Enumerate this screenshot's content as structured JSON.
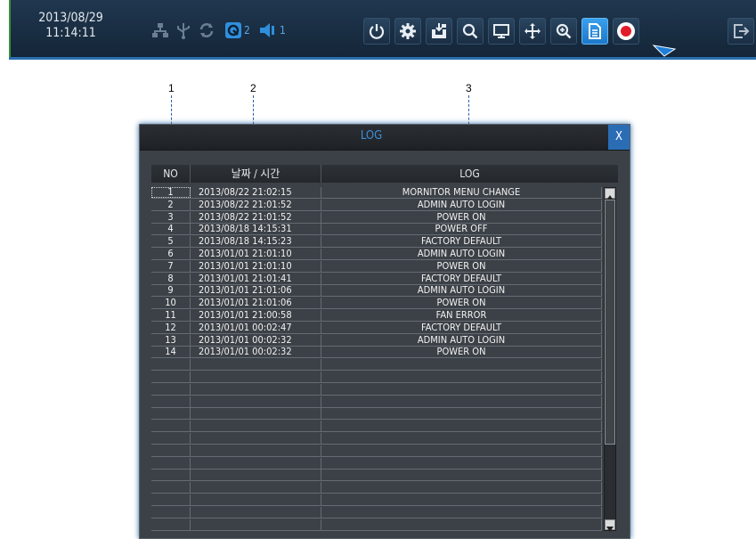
{
  "toolbar": {
    "date": "2013/08/29",
    "time": "11:14:11",
    "status": {
      "hdd_count": "2",
      "audio_count": "1"
    },
    "icons": [
      "network-icon",
      "usb-icon",
      "refresh-icon",
      "hdd-icon",
      "speaker-icon",
      "power-icon",
      "gear-icon",
      "save-icon",
      "search-icon",
      "monitor-icon",
      "move-icon",
      "zoom-icon",
      "log-icon",
      "record-icon",
      "exit-icon"
    ],
    "colors": {
      "accent": "#1e78c8",
      "record": "#e21b2b",
      "toolbar_bg": "#1a2e43"
    }
  },
  "callouts": [
    "1",
    "2",
    "3"
  ],
  "dialog": {
    "title": "LOG",
    "close_label": "X",
    "columns": [
      "NO",
      "날짜 / 시간",
      "LOG"
    ],
    "rows": [
      {
        "no": "1",
        "datetime": "2013/08/22 21:02:15",
        "log": "MORNITOR MENU CHANGE"
      },
      {
        "no": "2",
        "datetime": "2013/08/22 21:01:52",
        "log": "ADMIN AUTO LOGIN"
      },
      {
        "no": "3",
        "datetime": "2013/08/22 21:01:52",
        "log": "POWER ON"
      },
      {
        "no": "4",
        "datetime": "2013/08/18 14:15:31",
        "log": "POWER OFF"
      },
      {
        "no": "5",
        "datetime": "2013/08/18 14:15:23",
        "log": "FACTORY DEFAULT"
      },
      {
        "no": "6",
        "datetime": "2013/01/01 21:01:10",
        "log": "ADMIN AUTO LOGIN"
      },
      {
        "no": "7",
        "datetime": "2013/01/01 21:01:10",
        "log": "POWER ON"
      },
      {
        "no": "8",
        "datetime": "2013/01/01 21:01:41",
        "log": "FACTORY DEFAULT"
      },
      {
        "no": "9",
        "datetime": "2013/01/01 21:01:06",
        "log": "ADMIN AUTO LOGIN"
      },
      {
        "no": "10",
        "datetime": "2013/01/01 21:01:06",
        "log": "POWER ON"
      },
      {
        "no": "11",
        "datetime": "2013/01/01 21:00:58",
        "log": "FAN ERROR"
      },
      {
        "no": "12",
        "datetime": "2013/01/01 00:02:47",
        "log": "FACTORY DEFAULT"
      },
      {
        "no": "13",
        "datetime": "2013/01/01 00:02:32",
        "log": "ADMIN AUTO LOGIN"
      },
      {
        "no": "14",
        "datetime": "2013/01/01 00:02:32",
        "log": "POWER ON"
      }
    ],
    "empty_rows": 14
  }
}
